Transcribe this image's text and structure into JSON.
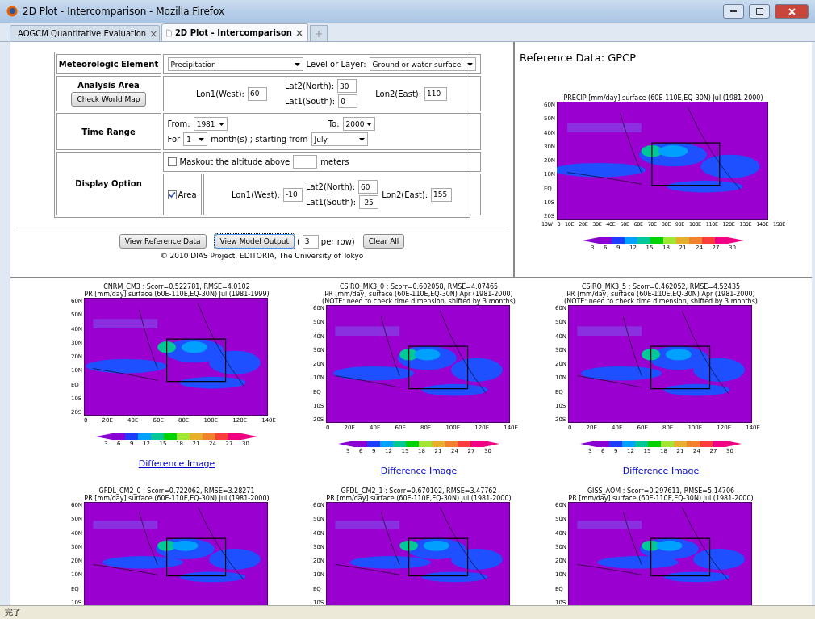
{
  "window": {
    "title": "2D Plot - Intercomparison - Mozilla Firefox"
  },
  "tabs": [
    {
      "label": "AOGCM Quantitative Evaluation",
      "selected": false,
      "close": "×"
    },
    {
      "label": "2D Plot - Intercomparison",
      "selected": true,
      "close": "×"
    }
  ],
  "form": {
    "element": {
      "label": "Meteorologic Element",
      "value": "Precipitation",
      "layer_label": "Level or Layer:",
      "layer_value": "Ground or water surface"
    },
    "area": {
      "label": "Analysis Area",
      "button": "Check World Map",
      "lon1_label": "Lon1(West):",
      "lon1": "60",
      "lat2_label": "Lat2(North):",
      "lat2": "30",
      "lat1_label": "Lat1(South):",
      "lat1": "0",
      "lon2_label": "Lon2(East):",
      "lon2": "110"
    },
    "time": {
      "label": "Time Range",
      "from_label": "From:",
      "from": "1981",
      "to_label": "To:",
      "to": "2000",
      "for_label": "For",
      "months": "1",
      "starting_label": "month(s) ; starting from",
      "start_month": "July"
    },
    "display": {
      "label": "Display Option",
      "maskout_label": "Maskout the altitude above",
      "maskout_checked": false,
      "meters_label": "meters",
      "area_label": "Area",
      "area_checked": true,
      "lon1_label": "Lon1(West):",
      "lon1": "-10",
      "lat2_label": "Lat2(North):",
      "lat2": "60",
      "lat1_label": "Lat1(South):",
      "lat1": "-25",
      "lon2_label": "Lon2(East):",
      "lon2": "155"
    }
  },
  "actions": {
    "reference_button": "View Reference Data",
    "model_button": "View Model Output",
    "open_paren": "(",
    "per_row": "3",
    "per_row_label": "per row)",
    "clear_button": "Clear All",
    "copyright": "© 2010 DIAS Project, EDITORIA, The University of Tokyo"
  },
  "reference": {
    "heading": "Reference Data: GPCP",
    "plot": {
      "title_lines": [
        "PRECIP [mm/day] surface (60E-110E,EQ-30N) Jul (1981-2000)"
      ],
      "y_ticks": [
        "60N",
        "50N",
        "40N",
        "30N",
        "20N",
        "10N",
        "EQ",
        "10S",
        "20S"
      ],
      "x_ticks": [
        "10W",
        "0",
        "10E",
        "20E",
        "30E",
        "40E",
        "50E",
        "60E",
        "70E",
        "80E",
        "90E",
        "100E",
        "110E",
        "120E",
        "130E",
        "140E",
        "150E"
      ],
      "colorbar": [
        "3",
        "6",
        "9",
        "12",
        "15",
        "18",
        "21",
        "24",
        "27",
        "30"
      ]
    }
  },
  "plots": [
    {
      "title_lines": [
        "CNRM_CM3 : Scorr=0.522781, RMSE=4.0102",
        "PR [mm/day] surface (60E-110E,EQ-30N) Jul (1981-1999)"
      ],
      "y_ticks": [
        "60N",
        "50N",
        "40N",
        "30N",
        "20N",
        "10N",
        "EQ",
        "10S",
        "20S"
      ],
      "x_ticks": [
        "0",
        "20E",
        "40E",
        "60E",
        "80E",
        "100E",
        "120E",
        "140E"
      ],
      "colorbar": [
        "3",
        "6",
        "9",
        "12",
        "15",
        "18",
        "21",
        "24",
        "27",
        "30"
      ],
      "link": "Difference Image"
    },
    {
      "title_lines": [
        "CSIRO_MK3_0 : Scorr=0.602058, RMSE=4.07465",
        "PR [mm/day] surface (60E-110E,EQ-30N) Apr (1981-2000)",
        "(NOTE: need to check time dimension, shifted by 3 months)"
      ],
      "y_ticks": [
        "60N",
        "50N",
        "40N",
        "30N",
        "20N",
        "10N",
        "EQ",
        "10S",
        "20S"
      ],
      "x_ticks": [
        "0",
        "20E",
        "40E",
        "60E",
        "80E",
        "100E",
        "120E",
        "140E"
      ],
      "colorbar": [
        "3",
        "6",
        "9",
        "12",
        "15",
        "18",
        "21",
        "24",
        "27",
        "30"
      ],
      "link": "Difference Image"
    },
    {
      "title_lines": [
        "CSIRO_MK3_5 : Scorr=0.462052, RMSE=4.52435",
        "PR [mm/day] surface (60E-110E,EQ-30N) Apr (1981-2000)",
        "(NOTE: need to check time dimension, shifted by 3 months)"
      ],
      "y_ticks": [
        "60N",
        "50N",
        "40N",
        "30N",
        "20N",
        "10N",
        "EQ",
        "10S",
        "20S"
      ],
      "x_ticks": [
        "0",
        "20E",
        "40E",
        "60E",
        "80E",
        "100E",
        "120E",
        "140E"
      ],
      "colorbar": [
        "3",
        "6",
        "9",
        "12",
        "15",
        "18",
        "21",
        "24",
        "27",
        "30"
      ],
      "link": "Difference Image"
    },
    {
      "title_lines": [
        "GFDL_CM2_0 : Scorr=0.722062, RMSE=3.28271",
        "PR [mm/day] surface (60E-110E,EQ-30N) Jul (1981-2000)"
      ],
      "y_ticks": [
        "60N",
        "50N",
        "40N",
        "30N",
        "20N",
        "10N",
        "EQ",
        "10S"
      ]
    },
    {
      "title_lines": [
        "GFDL_CM2_1 : Scorr=0.670102, RMSE=3.47762",
        "PR [mm/day] surface (60E-110E,EQ-30N) Jul (1981-2000)"
      ],
      "y_ticks": [
        "60N",
        "50N",
        "40N",
        "30N",
        "20N",
        "10N",
        "EQ",
        "10S"
      ]
    },
    {
      "title_lines": [
        "GISS_AOM : Scorr=0.297611, RMSE=5.14706",
        "PR [mm/day] surface (60E-110E,EQ-30N) Jul (1981-2000)"
      ],
      "y_ticks": [
        "60N",
        "50N",
        "40N",
        "30N",
        "20N",
        "10N",
        "EQ",
        "10S"
      ]
    }
  ],
  "status_bar": {
    "text": "完了"
  }
}
